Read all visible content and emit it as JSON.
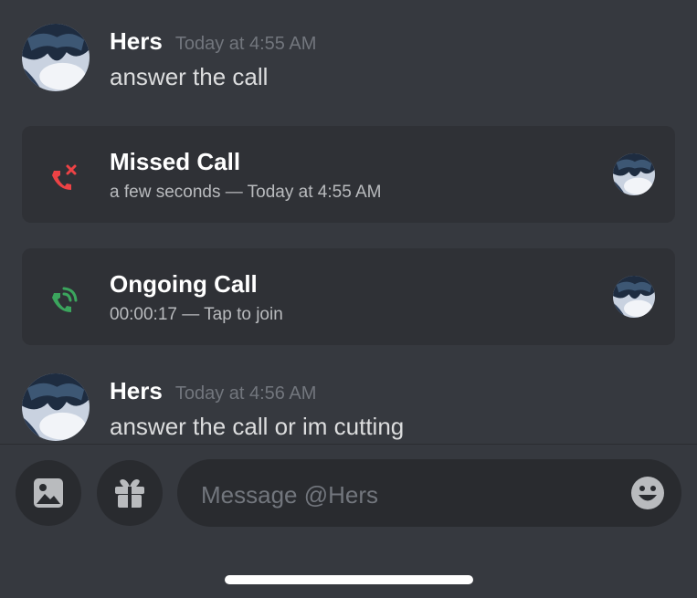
{
  "messages": [
    {
      "author": "Hers",
      "timestamp": "Today at 4:55 AM",
      "text": "answer the call"
    },
    {
      "author": "Hers",
      "timestamp": "Today at 4:56 AM",
      "text": "answer the call or im cutting"
    }
  ],
  "calls": [
    {
      "title": "Missed Call",
      "subtitle": "a few seconds — Today at 4:55 AM",
      "icon": "missed-call-icon",
      "color": "#ed4245"
    },
    {
      "title": "Ongoing Call",
      "subtitle": "00:00:17 — Tap to join",
      "icon": "ongoing-call-icon",
      "color": "#3ba55d"
    }
  ],
  "composer": {
    "placeholder": "Message @Hers",
    "image_icon": "image-icon",
    "gift_icon": "gift-icon",
    "emoji_icon": "emoji-icon"
  },
  "colors": {
    "background": "#36393f",
    "card": "#2f3136",
    "input": "#292b2f",
    "missed": "#ed4245",
    "ongoing": "#3ba55d"
  }
}
